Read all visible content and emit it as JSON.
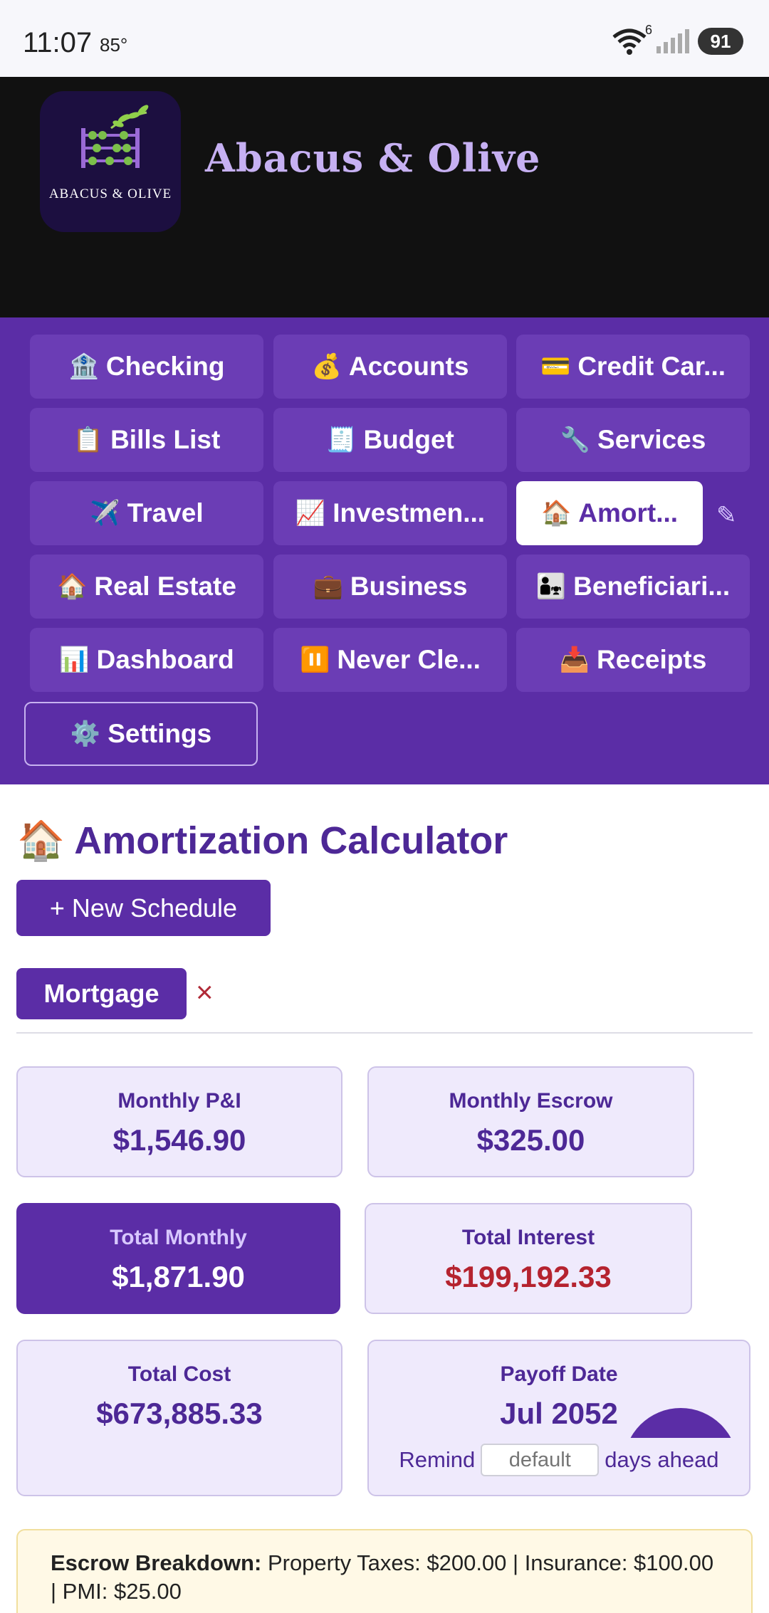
{
  "status_bar": {
    "time": "11:07",
    "temp": "85°",
    "wifi_label": "6",
    "battery": "91"
  },
  "header": {
    "logo_text": "ABACUS & OLIVE",
    "brand": "Abacus & Olive"
  },
  "nav": {
    "items": [
      {
        "icon": "🏦",
        "label": "Checking"
      },
      {
        "icon": "💰",
        "label": "Accounts"
      },
      {
        "icon": "💳",
        "label": "Credit Car..."
      },
      {
        "icon": "📋",
        "label": "Bills List"
      },
      {
        "icon": "🧾",
        "label": "Budget"
      },
      {
        "icon": "🔧",
        "label": "Services"
      },
      {
        "icon": "✈️",
        "label": "Travel"
      },
      {
        "icon": "📈",
        "label": "Investmen..."
      },
      {
        "icon": "🏠",
        "label": "Amort..."
      },
      {
        "icon": "🏠",
        "label": "Real Estate"
      },
      {
        "icon": "💼",
        "label": "Business"
      },
      {
        "icon": "👨‍👧",
        "label": "Beneficiari..."
      },
      {
        "icon": "📊",
        "label": "Dashboard"
      },
      {
        "icon": "⏸️",
        "label": "Never Cle..."
      },
      {
        "icon": "📥",
        "label": "Receipts"
      },
      {
        "icon": "⚙️",
        "label": "Settings"
      }
    ],
    "edit_icon": "✎"
  },
  "main": {
    "title_icon": "🏠",
    "title": "Amortization Calculator",
    "new_schedule": "+ New Schedule",
    "chip": "Mortgage",
    "chip_close": "×",
    "cards": [
      {
        "label": "Monthly P&I",
        "value": "$1,546.90"
      },
      {
        "label": "Monthly Escrow",
        "value": "$325.00"
      },
      {
        "label": "Total Monthly",
        "value": "$1,871.90"
      },
      {
        "label": "Total Interest",
        "value": "$199,192.33"
      },
      {
        "label": "Total Cost",
        "value": "$673,885.33"
      },
      {
        "label": "Payoff Date",
        "value": "Jul 2052"
      }
    ],
    "remind": {
      "prefix": "Remind",
      "placeholder": "default",
      "suffix": "days ahead"
    },
    "escrow": {
      "label": "Escrow Breakdown:",
      "text": "Property Taxes: $200.00  |  Insurance: $100.00  |  PMI: $25.00"
    }
  },
  "colors": {
    "primary": "#5b2da6",
    "nav_bg": "#5b2da6",
    "header_bg": "#111111",
    "accent_text": "#c6b0f2",
    "danger": "#b5232f"
  }
}
